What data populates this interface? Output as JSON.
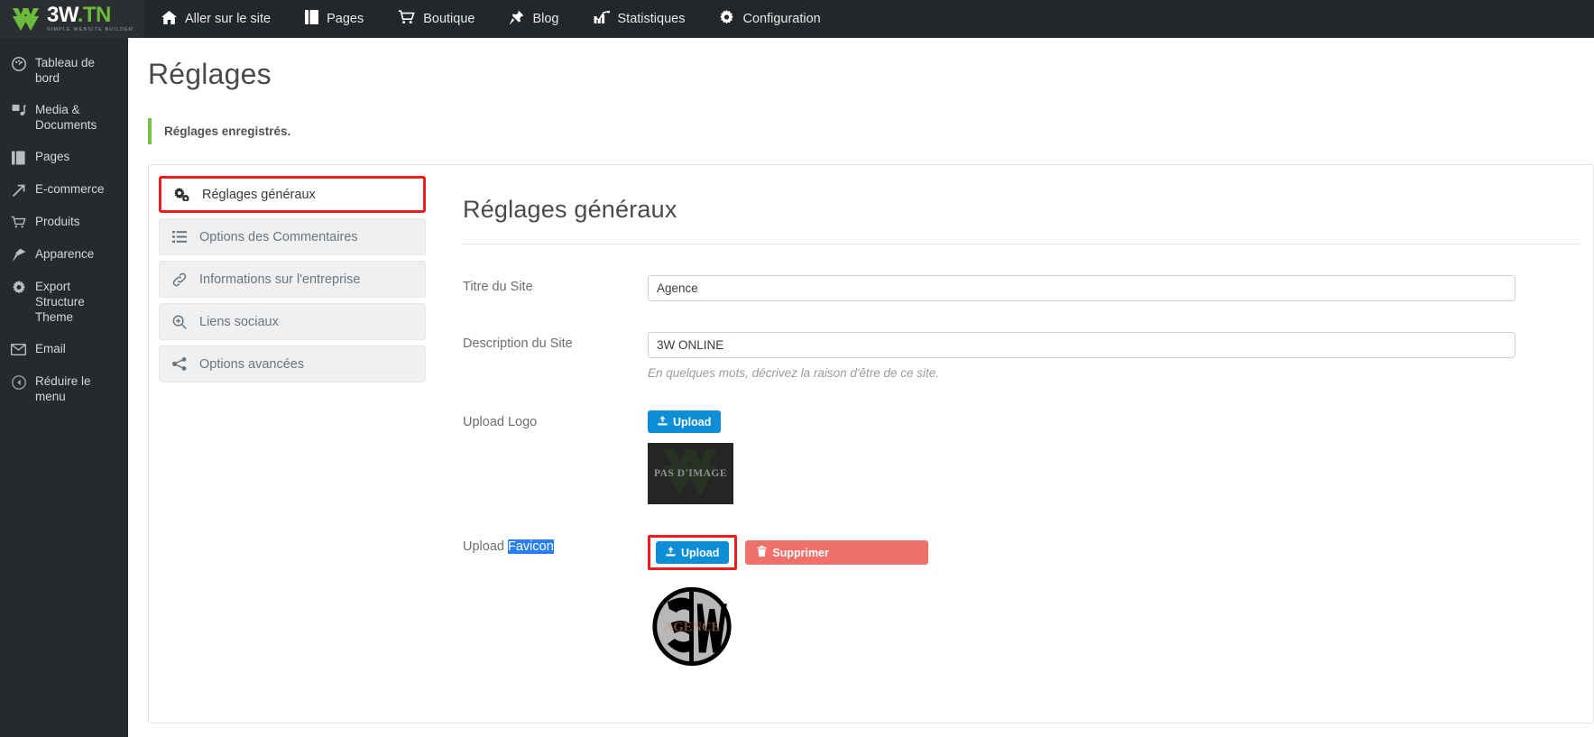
{
  "brand": {
    "title_main": "3W",
    "title_accent": ".TN",
    "tagline": "SIMPLE WEBSITE BUILDER"
  },
  "topnav": {
    "items": [
      {
        "label": "Aller sur le site",
        "icon": "home-icon"
      },
      {
        "label": "Pages",
        "icon": "pages-icon"
      },
      {
        "label": "Boutique",
        "icon": "cart-icon"
      },
      {
        "label": "Blog",
        "icon": "pin-icon"
      },
      {
        "label": "Statistiques",
        "icon": "chart-icon"
      },
      {
        "label": "Configuration",
        "icon": "gear-icon"
      }
    ]
  },
  "sidebar": {
    "items": [
      {
        "label": "Tableau de bord",
        "icon": "dashboard-icon"
      },
      {
        "label": "Media & Documents",
        "icon": "media-icon"
      },
      {
        "label": "Pages",
        "icon": "pages-icon"
      },
      {
        "label": "E-commerce",
        "icon": "arrow-up-icon"
      },
      {
        "label": "Produits",
        "icon": "cart-icon"
      },
      {
        "label": "Apparence",
        "icon": "brush-icon"
      },
      {
        "label": "Export Structure Theme",
        "icon": "gear-icon"
      },
      {
        "label": "Email",
        "icon": "envelope-icon"
      },
      {
        "label": "Réduire le menu",
        "icon": "collapse-icon"
      }
    ]
  },
  "page": {
    "title": "Réglages",
    "alert": "Réglages enregistrés."
  },
  "tabs": [
    {
      "label": "Réglages généraux",
      "icon": "cogs-icon",
      "active": true
    },
    {
      "label": "Options des Commentaires",
      "icon": "list-icon",
      "active": false
    },
    {
      "label": "Informations sur l'entreprise",
      "icon": "link-icon",
      "active": false
    },
    {
      "label": "Liens sociaux",
      "icon": "search-plus-icon",
      "active": false
    },
    {
      "label": "Options avancées",
      "icon": "share-icon",
      "active": false
    }
  ],
  "form": {
    "heading": "Réglages généraux",
    "site_title": {
      "label": "Titre du Site",
      "value": "Agence"
    },
    "site_description": {
      "label": "Description du Site",
      "value": "3W ONLINE",
      "help": "En quelques mots, décrivez la raison d'être de ce site."
    },
    "upload_logo": {
      "label": "Upload Logo",
      "upload_button": "Upload",
      "preview_text": "PAS D'IMAGE"
    },
    "upload_favicon": {
      "label_prefix": "Upload ",
      "label_selected": "Favicon",
      "upload_button": "Upload",
      "delete_button": "Supprimer"
    }
  },
  "colors": {
    "topbar": "#23272a",
    "sidebar": "#262a2c",
    "accent_green": "#6cbb3c",
    "primary_blue": "#0e8ed6",
    "danger_red": "#f0706c",
    "highlight_red": "#ef1c1c",
    "selection_blue": "#2a7ff0"
  }
}
